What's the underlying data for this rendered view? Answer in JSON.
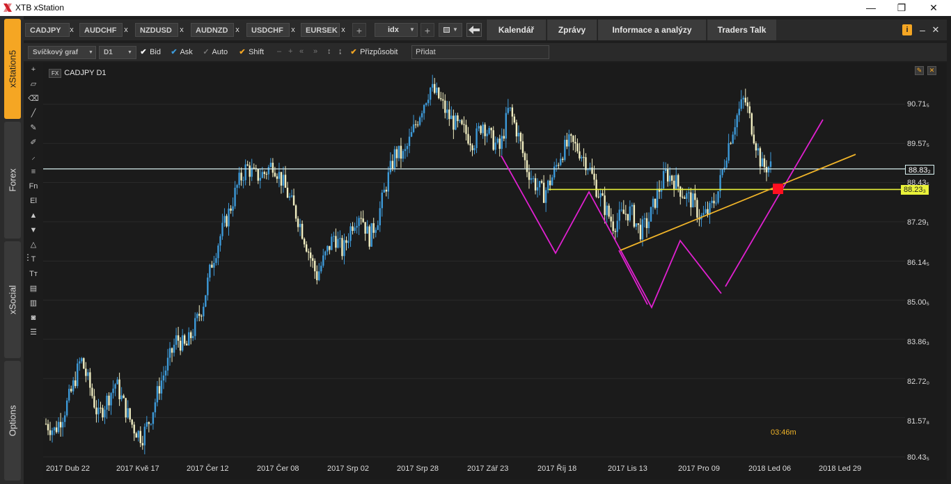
{
  "window": {
    "title": "XTB xStation",
    "minimize": "—",
    "maximize": "❐",
    "close": "✕"
  },
  "rail": {
    "tabs": [
      "xStation5",
      "Forex",
      "xSocial",
      "Options"
    ]
  },
  "symbols": [
    "CADJPY",
    "AUDCHF",
    "NZDUSD",
    "AUDNZD",
    "USDCHF",
    "EURSEK"
  ],
  "symbol_close": "x",
  "add_symbol": "+",
  "idx_select": "idx",
  "add_plus": "+",
  "nav_tabs": [
    "Kalendář",
    "Zprávy",
    "Informace a analýzy",
    "Traders Talk"
  ],
  "toolbar": {
    "chart_type": "Svíčkový graf",
    "timeframe": "D1",
    "bid_label": "Bid",
    "ask_label": "Ask",
    "auto_label": "Auto",
    "shift_label": "Shift",
    "customize_label": "Přizpůsobit",
    "add_input_value": "Přidat"
  },
  "draw_tools": [
    "+",
    "Fn",
    "El",
    "T",
    "Tт"
  ],
  "chart": {
    "instrument": "CADJPY D1",
    "fx_badge": "FX",
    "timer": "03:46m",
    "bid_tag": "88.83₂",
    "level_tag": "88.23₃",
    "colors": {
      "bull": "#3d9ad9",
      "bear": "#f2efc2",
      "bid_line": "#d9f2f2",
      "level_line": "#e9f23a",
      "trend_line": "#f0b429",
      "pattern": "#e020d0",
      "marker": "#ff1020"
    }
  },
  "chart_data": {
    "type": "candlestick",
    "title": "CADJPY D1",
    "y_ticks": [
      "90.71₅",
      "89.57₅",
      "88.43₅",
      "87.29₁",
      "86.14₅",
      "85.00₅",
      "83.86₃",
      "82.72₀",
      "81.57₈",
      "80.43₅"
    ],
    "y_tick_values": [
      90.715,
      89.575,
      88.435,
      87.291,
      86.145,
      85.005,
      83.863,
      82.72,
      81.578,
      80.435
    ],
    "x_ticks": [
      "2017 Dub 22",
      "2017 Kvě 17",
      "2017 Čer 12",
      "2017 Čer 08",
      "2017 Srp 02",
      "2017 Srp 28",
      "2017 Zář 23",
      "2017 Říj 18",
      "2017 Lis 13",
      "2017 Pro 09",
      "2018 Led 06",
      "2018 Led 29"
    ],
    "ylim": [
      80.3,
      92.3
    ],
    "bid_price": 88.832,
    "horizontal_level": 88.233,
    "close_path": [
      81.4,
      81.2,
      81.7,
      82.4,
      83.3,
      82.5,
      81.6,
      82.1,
      82.6,
      81.9,
      81.3,
      81.0,
      81.6,
      82.5,
      83.2,
      83.9,
      83.6,
      84.2,
      84.9,
      86.1,
      86.9,
      87.6,
      88.4,
      88.9,
      88.6,
      88.7,
      89.0,
      88.5,
      87.9,
      87.3,
      86.5,
      85.7,
      86.3,
      86.9,
      86.4,
      87.2,
      87.6,
      86.8,
      87.4,
      88.4,
      89.3,
      89.2,
      89.9,
      90.6,
      91.2,
      90.9,
      90.4,
      90.1,
      89.9,
      89.6,
      90.2,
      89.7,
      89.4,
      90.6,
      89.9,
      88.9,
      88.4,
      88.1,
      88.6,
      89.3,
      89.6,
      89.4,
      89.0,
      88.3,
      87.7,
      87.2,
      87.5,
      87.6,
      87.0,
      87.3,
      88.1,
      88.7,
      88.5,
      88.1,
      87.9,
      87.4,
      87.6,
      88.2,
      89.4,
      90.3,
      90.9,
      89.9,
      88.9,
      88.9
    ]
  }
}
